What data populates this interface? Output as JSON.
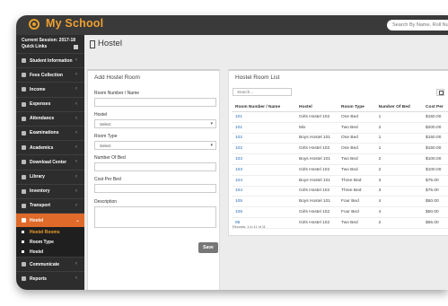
{
  "app": {
    "title": "My School",
    "search_placeholder": "Search By Name, Roll Num"
  },
  "sidebar": {
    "session": "Current Session: 2017-18",
    "quick_links": "Quick Links",
    "items": [
      {
        "label": "Student Information",
        "icon": "user-icon"
      },
      {
        "label": "Fees Collection",
        "icon": "money-icon"
      },
      {
        "label": "Income",
        "icon": "dollar-icon"
      },
      {
        "label": "Expenses",
        "icon": "credit-card-icon"
      },
      {
        "label": "Attendance",
        "icon": "calendar-check-icon"
      },
      {
        "label": "Examinations",
        "icon": "map-icon"
      },
      {
        "label": "Academics",
        "icon": "mortarboard-icon"
      },
      {
        "label": "Download Center",
        "icon": "download-icon"
      },
      {
        "label": "Library",
        "icon": "book-icon"
      },
      {
        "label": "Inventory",
        "icon": "object-group-icon"
      },
      {
        "label": "Transport",
        "icon": "bus-icon"
      },
      {
        "label": "Hostel",
        "icon": "building-icon"
      }
    ],
    "sub_items": [
      {
        "label": "Hostel Rooms"
      },
      {
        "label": "Room Type"
      },
      {
        "label": "Hostel"
      }
    ],
    "after_items": [
      {
        "label": "Communicate",
        "icon": "bullhorn-icon"
      },
      {
        "label": "Reports",
        "icon": "line-chart-icon"
      }
    ]
  },
  "page": {
    "title": "Hostel"
  },
  "form": {
    "title": "Add Hostel Room",
    "room_number_label": "Room Number / Name",
    "hostel_label": "Hostel",
    "hostel_value": "Select",
    "room_type_label": "Room Type",
    "room_type_value": "Select",
    "beds_label": "Number Of Bed",
    "cost_label": "Cost Per Bed",
    "description_label": "Description",
    "save": "Save"
  },
  "list": {
    "title": "Hostel Room List",
    "search_placeholder": "Search...",
    "columns": [
      "Room Number / Name",
      "Hostel",
      "Room Type",
      "Number Of Bed",
      "Cost Per"
    ],
    "rows": [
      [
        "101",
        "Girls Hostel 102",
        "One Bed",
        "1",
        "$150.00"
      ],
      [
        "101",
        "Mix",
        "Two Bed",
        "2",
        "$200.00"
      ],
      [
        "102",
        "Boys Hostel 101",
        "One Bed",
        "1",
        "$150.00"
      ],
      [
        "102",
        "Girls Hostel 102",
        "One Bed",
        "1",
        "$150.00"
      ],
      [
        "103",
        "Boys Hostel 101",
        "Two Bed",
        "2",
        "$100.00"
      ],
      [
        "103",
        "Girls Hostel 102",
        "Two Bed",
        "2",
        "$100.00"
      ],
      [
        "104",
        "Boys Hostel 101",
        "Three Bed",
        "3",
        "$75.00"
      ],
      [
        "104",
        "Girls Hostel 102",
        "Three Bed",
        "3",
        "$75.00"
      ],
      [
        "105",
        "Boys Hostel 101",
        "Four Bed",
        "4",
        "$50.00"
      ],
      [
        "105",
        "Girls Hostel 102",
        "Four Bed",
        "4",
        "$50.00"
      ],
      [
        "95",
        "Girls Hostel 102",
        "Two Bed",
        "2",
        "$65.00"
      ]
    ],
    "records": "Records: 1 to 11 of 11"
  }
}
